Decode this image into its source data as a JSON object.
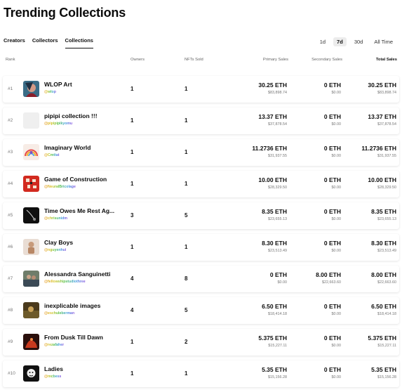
{
  "page_title": "Trending Collections",
  "tabs": [
    "Creators",
    "Collectors",
    "Collections"
  ],
  "active_tab": "Collections",
  "periods": [
    "1d",
    "7d",
    "30d",
    "All Time"
  ],
  "active_period": "7d",
  "columns": {
    "rank": "Rank",
    "owners": "Owners",
    "nfts_sold": "NFTs Sold",
    "primary_sales": "Primary Sales",
    "secondary_sales": "Secondary Sales",
    "total_sales": "Total Sales"
  },
  "rows": [
    {
      "rank": "#1",
      "name": "WLOP Art",
      "handle": "@wlop",
      "owners": "1",
      "nfts": "1",
      "primary_eth": "30.25 ETH",
      "primary_usd": "$83,898.74",
      "secondary_eth": "0 ETH",
      "secondary_usd": "$0.00",
      "total_eth": "30.25 ETH",
      "total_usd": "$83,898.74"
    },
    {
      "rank": "#2",
      "name": "pipipi collection !!!",
      "handle": "@pipipipikyomu",
      "owners": "1",
      "nfts": "1",
      "primary_eth": "13.37 ETH",
      "primary_usd": "$37,878.54",
      "secondary_eth": "0 ETH",
      "secondary_usd": "$0.00",
      "total_eth": "13.37 ETH",
      "total_usd": "$37,878.54"
    },
    {
      "rank": "#3",
      "name": "Imaginary World",
      "handle": "@Cmttat",
      "owners": "1",
      "nfts": "1",
      "primary_eth": "11.2736 ETH",
      "primary_usd": "$31,937.55",
      "secondary_eth": "0 ETH",
      "secondary_usd": "$0.00",
      "total_eth": "11.2736 ETH",
      "total_usd": "$31,937.55"
    },
    {
      "rank": "#4",
      "name": "Game of Construction",
      "handle": "@NeuralBricolage",
      "owners": "1",
      "nfts": "1",
      "primary_eth": "10.00 ETH",
      "primary_usd": "$28,329.50",
      "secondary_eth": "0 ETH",
      "secondary_usd": "$0.00",
      "total_eth": "10.00 ETH",
      "total_usd": "$28,329.50"
    },
    {
      "rank": "#5",
      "name": "Time Owes Me Rest Ag...",
      "handle": "@chrisunidm",
      "owners": "3",
      "nfts": "5",
      "primary_eth": "8.35 ETH",
      "primary_usd": "$23,655.13",
      "secondary_eth": "0 ETH",
      "secondary_usd": "$0.00",
      "total_eth": "8.35 ETH",
      "total_usd": "$23,655.13"
    },
    {
      "rank": "#6",
      "name": "Clay Boys",
      "handle": "@nguyenhui",
      "owners": "1",
      "nfts": "1",
      "primary_eth": "8.30 ETH",
      "primary_usd": "$23,513.49",
      "secondary_eth": "0 ETH",
      "secondary_usd": "$0.00",
      "total_eth": "8.30 ETH",
      "total_usd": "$23,513.49"
    },
    {
      "rank": "#7",
      "name": "Alessandra Sanguinetti",
      "handle": "@fellowshipstudiothree",
      "owners": "4",
      "nfts": "8",
      "primary_eth": "0 ETH",
      "primary_usd": "$0.00",
      "secondary_eth": "8.00 ETH",
      "secondary_usd": "$22,663.60",
      "total_eth": "8.00 ETH",
      "total_usd": "$22,663.60"
    },
    {
      "rank": "#8",
      "name": "inexplicable images",
      "handle": "@eschuleberman",
      "owners": "4",
      "nfts": "5",
      "primary_eth": "6.50 ETH",
      "primary_usd": "$18,414.18",
      "secondary_eth": "0 ETH",
      "secondary_usd": "$0.00",
      "total_eth": "6.50 ETH",
      "total_usd": "$18,414.18"
    },
    {
      "rank": "#9",
      "name": "From Dusk Till Dawn",
      "handle": "@rezafaher",
      "owners": "1",
      "nfts": "2",
      "primary_eth": "5.375 ETH",
      "primary_usd": "$15,227.11",
      "secondary_eth": "0 ETH",
      "secondary_usd": "$0.00",
      "total_eth": "5.375 ETH",
      "total_usd": "$15,227.11"
    },
    {
      "rank": "#10",
      "name": "Ladies",
      "handle": "@mcbess",
      "owners": "1",
      "nfts": "1",
      "primary_eth": "5.35 ETH",
      "primary_usd": "$15,156.28",
      "secondary_eth": "0 ETH",
      "secondary_usd": "$0.00",
      "total_eth": "5.35 ETH",
      "total_usd": "$15,156.28"
    }
  ],
  "thumbnails": [
    "wlop-portrait-thumb",
    "pipipi-blank-thumb",
    "imaginary-world-rainbow-thumb",
    "game-of-construction-red-thumb",
    "time-owes-me-rest-dark-thumb",
    "clay-boys-figure-thumb",
    "alessandra-photo-thumb",
    "inexplicable-images-thumb",
    "dusk-till-dawn-thumb",
    "ladies-illustration-thumb"
  ]
}
